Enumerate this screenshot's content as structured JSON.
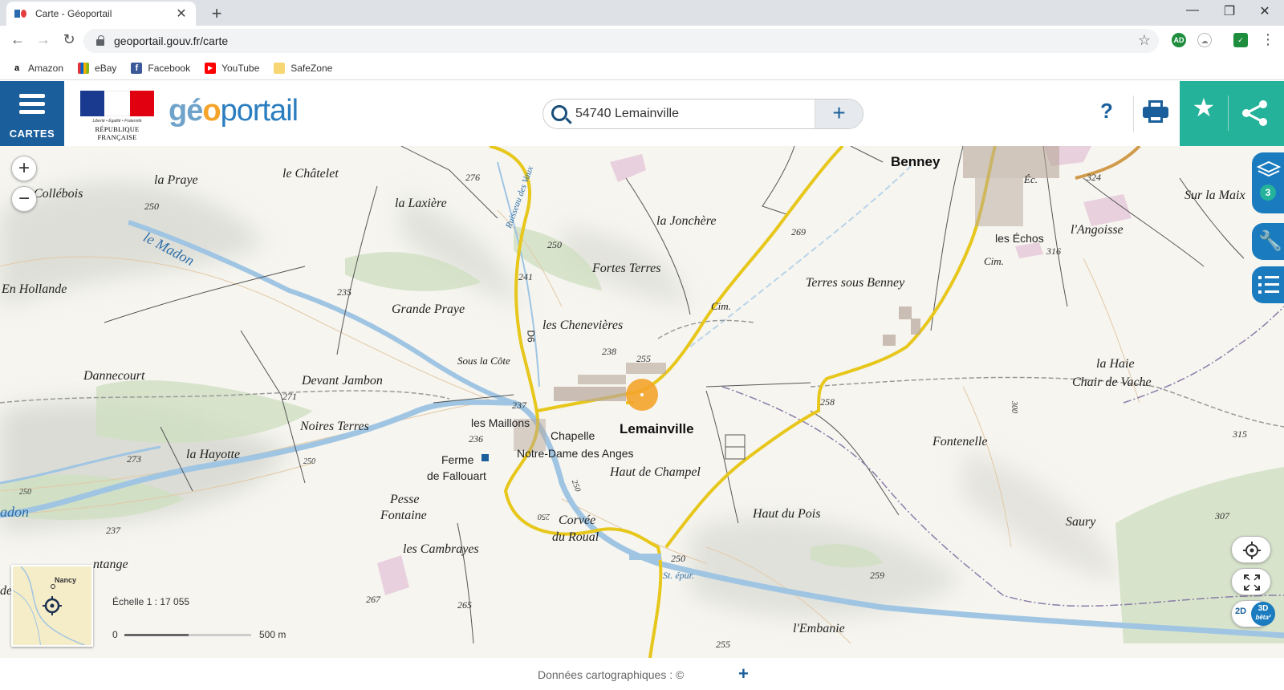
{
  "browser": {
    "tab_title": "Carte - Géoportail",
    "url": "geoportail.gouv.fr/carte",
    "bookmarks": [
      {
        "label": "Amazon",
        "icon": "amazon-icon"
      },
      {
        "label": "eBay",
        "icon": "ebay-icon"
      },
      {
        "label": "Facebook",
        "icon": "facebook-icon"
      },
      {
        "label": "YouTube",
        "icon": "youtube-icon"
      },
      {
        "label": "SafeZone",
        "icon": "folder-icon"
      }
    ],
    "extensions": [
      "AD"
    ]
  },
  "header": {
    "cartes_label": "CARTES",
    "rf_motto": "Liberté • Égalité • Fraternité",
    "rf_name": "RÉPUBLIQUE FRANÇAISE",
    "logo_geo": "gé",
    "logo_o": "o",
    "logo_portail": "portail",
    "search_value": "54740 Lemainville",
    "help_label": "?"
  },
  "map": {
    "layers_count": "3",
    "scale_text": "Échelle 1 : 17 055",
    "scale_min": "0",
    "scale_max": "500 m",
    "minimap_city": "Nancy",
    "btn_2d": "2D",
    "btn_3d": "3D",
    "btn_3d_sub": "bêta²",
    "labels": {
      "benney": "Benney",
      "lemainville": "Lemainville",
      "la_praye": "la Praye",
      "le_chatelet": "le Châtelet",
      "collebois": "Collébois",
      "la_laxiere": "la Laxière",
      "la_jonchere": "la Jonchère",
      "le_madon": "le Madon",
      "en_hollande": "En Hollande",
      "fortes_terres": "Fortes Terres",
      "grande_praye": "Grande Praye",
      "les_chenevieres": "les Chenevières",
      "terres_sous_benney": "Terres sous Benney",
      "sous_la_cote": "Sous la Côte",
      "dannecourt": "Dannecourt",
      "devant_jambon": "Devant Jambon",
      "noires_terres": "Noires Terres",
      "les_maillons": "les Maillons",
      "chapelle": "Chapelle",
      "notre_dame": "Notre-Dame des Anges",
      "la_hayotte": "la Hayotte",
      "ferme": "Ferme",
      "de_fallouart": "de Fallouart",
      "haut_de_champel": "Haut de Champel",
      "fontenelle": "Fontenelle",
      "la_haie": "la Haie",
      "chair_de_vache": "Chair de Vache",
      "pesse": "Pesse",
      "fontaine": "Fontaine",
      "corvee": "Corvée",
      "du_roual": "du Roual",
      "haut_du_pois": "Haut du Pois",
      "saury": "Saury",
      "les_cambrayes": "les Cambrayes",
      "tange": "ntange",
      "madon_short": "adon",
      "lembanie": "l'Embanie",
      "sur_la_maix": "Sur la Maix",
      "langoisse": "l'Angoisse",
      "les_echos": "les Échos",
      "cim1": "Cim.",
      "cim2": "Cim.",
      "ec": "Éc.",
      "st_epur": "St. épur.",
      "ruisseau": "Ruisseau des Vaux",
      "d6": "D6",
      "de_left": "de"
    },
    "altitudes": [
      "276",
      "250",
      "269",
      "324",
      "235",
      "241",
      "250",
      "316",
      "238",
      "255",
      "271",
      "237",
      "258",
      "300",
      "315",
      "236",
      "273",
      "250",
      "250",
      "250",
      "237",
      "250",
      "307",
      "250",
      "259",
      "267",
      "265",
      "255"
    ]
  },
  "footer": {
    "text": "Données cartographiques : ©",
    "plus": "+"
  }
}
